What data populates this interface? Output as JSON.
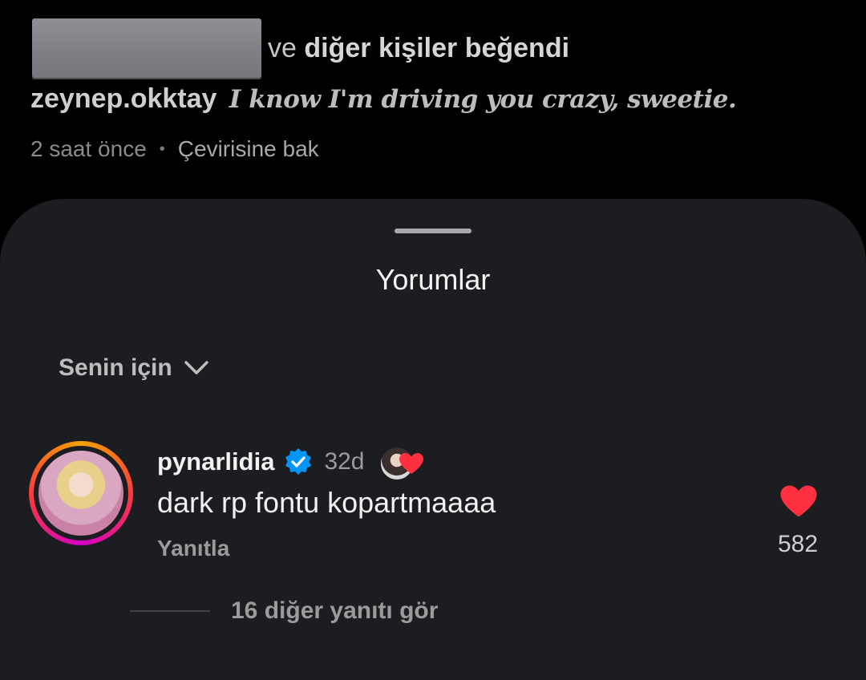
{
  "post": {
    "likes_suffix_plain": "ve",
    "likes_suffix_bold": "diğer kişiler beğendi",
    "caption_user": "zeynep.okktay",
    "caption_text": "I know I'm driving you crazy, sweetie.",
    "time": "2 saat önce",
    "separator": "•",
    "translate_label": "Çevirisine bak"
  },
  "comments_sheet": {
    "title": "Yorumlar",
    "filter_label": "Senin için"
  },
  "comment": {
    "username": "pynarlidia",
    "age": "32d",
    "text": "dark rp fontu kopartmaaaa",
    "reply_label": "Yanıtla",
    "like_count": "582",
    "more_replies": "16 diğer yanıtı gör"
  },
  "colors": {
    "like_red": "#ff3040",
    "verified_blue": "#0095f6"
  },
  "icons": [
    "chevron-down-icon",
    "verified-badge-icon",
    "heart-icon"
  ]
}
